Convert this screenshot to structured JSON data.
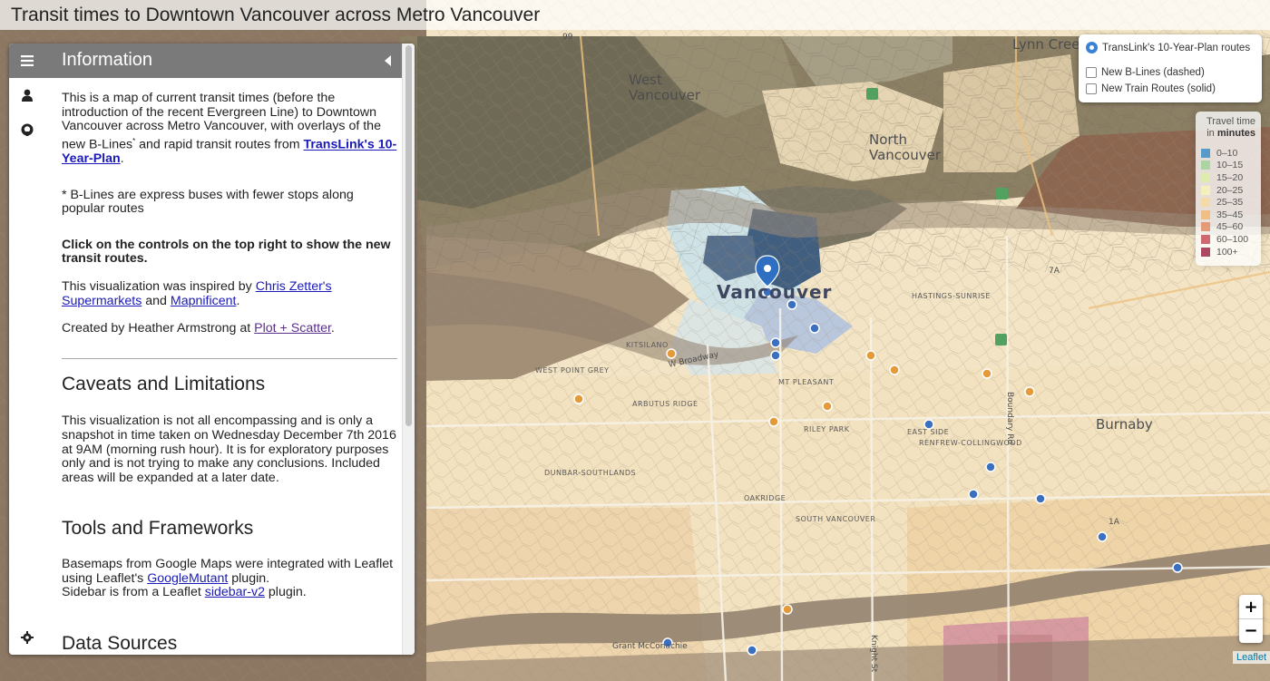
{
  "header": {
    "title": "Transit times to Downtown Vancouver across Metro Vancouver"
  },
  "sidebar": {
    "tabs": [
      {
        "icon": "menu-icon"
      },
      {
        "icon": "user-icon"
      },
      {
        "icon": "github-icon"
      },
      {
        "icon": "gear-icon"
      }
    ],
    "pane_title": "Information",
    "intro": {
      "text1": "This is a map of current transit times (before the introduction of the recent Evergreen Line) to Downtown Vancouver across Metro Vancouver, with overlays of the new B-Lines",
      "sup": "*",
      "text2": " and rapid transit routes from ",
      "link": "TransLink's 10-Year-Plan",
      "text3": "."
    },
    "footnote": "* B-Lines are express buses with fewer stops along popular routes",
    "instruction": "Click on the controls on the top right to show the new transit routes.",
    "inspired": {
      "text1": "This visualization was inspired by ",
      "link1": "Chris Zetter's Supermarkets",
      "text2": " and ",
      "link2": "Mapnificent",
      "text3": "."
    },
    "credit": {
      "text1": "Created by Heather Armstrong at ",
      "link": "Plot + Scatter",
      "text2": "."
    },
    "caveats_heading": "Caveats and Limitations",
    "caveats_text": "This visualization is not all encompassing and is only a snapshot in time taken on Wednesday December 7th 2016 at 9AM (morning rush hour). It is for exploratory purposes only and is not trying to make any conclusions. Included areas will be expanded at a later date.",
    "tools_heading": "Tools and Frameworks",
    "tools": {
      "text1": "Basemaps from Google Maps were integrated with Leaflet using Leaflet's ",
      "link1": "GoogleMutant",
      "text2": " plugin.",
      "text3": "Sidebar is from a Leaflet ",
      "link2": "sidebar-v2",
      "text4": " plugin."
    },
    "next_heading": "Data Sources"
  },
  "layers": {
    "base": "TransLink's 10-Year-Plan routes",
    "overlays": [
      "New B-Lines (dashed)",
      "New Train Routes (solid)"
    ]
  },
  "legend": {
    "title1": "Travel time",
    "title2": "in",
    "title3": "minutes",
    "items": [
      {
        "label": "0–10",
        "color": "#3d8fc6"
      },
      {
        "label": "10–15",
        "color": "#9fd39a"
      },
      {
        "label": "15–20",
        "color": "#dcefa8"
      },
      {
        "label": "20–25",
        "color": "#f7f3b6"
      },
      {
        "label": "25–35",
        "color": "#f6d9a0"
      },
      {
        "label": "35–45",
        "color": "#f0b978"
      },
      {
        "label": "45–60",
        "color": "#e38d64"
      },
      {
        "label": "60–100",
        "color": "#c8505a"
      },
      {
        "label": "100+",
        "color": "#9c2a4c"
      }
    ]
  },
  "zoom": {
    "in": "+",
    "out": "−"
  },
  "attribution": "Leaflet",
  "map_labels": {
    "vancouver": "Vancouver",
    "north_vancouver": "North\nVancouver",
    "west_vancouver": "West\nVancouver",
    "burnaby": "Burnaby",
    "lynn_creek": "Lynn Creek",
    "west_point_grey": "WEST POINT GREY",
    "kitsilano": "KITSILANO",
    "arbutus_ridge": "ARBUTUS RIDGE",
    "mt_pleasant": "MT PLEASANT",
    "hastings_sunrise": "HASTINGS-SUNRISE",
    "renfrew": "RENFREW-COLLINGWOOD",
    "east_side": "EAST SIDE",
    "riley_park": "RILEY PARK",
    "dunbar": "DUNBAR-SOUTHLANDS",
    "oakridge": "OAKRIDGE",
    "south_vancouver": "SOUTH VANCOUVER",
    "broadway": "W Broadway",
    "grant_mcconachie": "Grant McConachie",
    "boundary_rd": "Boundary Rd",
    "knight_st": "Knight St",
    "route_99": "99",
    "route_1a": "1A",
    "route_7a": "7A"
  }
}
